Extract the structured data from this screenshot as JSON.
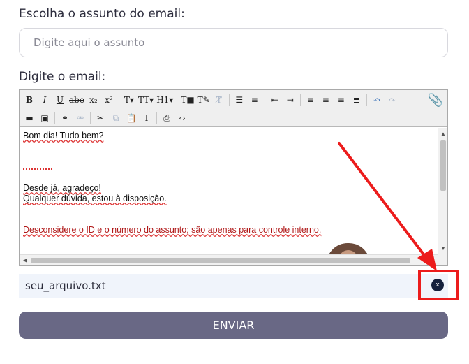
{
  "form": {
    "subject_label": "Escolha o assunto do email:",
    "subject_placeholder": "Digite aqui o assunto",
    "subject_value": "",
    "email_label": "Digite o email:",
    "send_label": "ENVIAR"
  },
  "toolbar": {
    "row1": [
      {
        "name": "bold-button",
        "glyph": "B"
      },
      {
        "name": "italic-button",
        "glyph": "I"
      },
      {
        "name": "underline-button",
        "glyph": "U"
      },
      {
        "name": "strikethrough-button",
        "glyph": "abe"
      },
      {
        "name": "subscript-button",
        "glyph": "x₂"
      },
      {
        "name": "superscript-button",
        "glyph": "x²"
      },
      {
        "name": "font-family-button",
        "glyph": "T▾"
      },
      {
        "name": "font-size-button",
        "glyph": "TT▾"
      },
      {
        "name": "heading-button",
        "glyph": "H1▾"
      },
      {
        "name": "text-color-button",
        "glyph": "T■"
      },
      {
        "name": "highlight-button",
        "glyph": "T✎"
      },
      {
        "name": "clear-format-button",
        "glyph": "T̸"
      },
      {
        "name": "bullet-list-button",
        "glyph": "☰"
      },
      {
        "name": "numbered-list-button",
        "glyph": "≡"
      },
      {
        "name": "outdent-button",
        "glyph": "⇤"
      },
      {
        "name": "indent-button",
        "glyph": "⇥"
      },
      {
        "name": "align-left-button",
        "glyph": "≡"
      },
      {
        "name": "align-center-button",
        "glyph": "≡"
      },
      {
        "name": "align-right-button",
        "glyph": "≡"
      },
      {
        "name": "justify-button",
        "glyph": "≣"
      },
      {
        "name": "undo-button",
        "glyph": "↶"
      },
      {
        "name": "redo-button",
        "glyph": "↷"
      }
    ],
    "row2": [
      {
        "name": "horizontal-rule-button",
        "glyph": "▬"
      },
      {
        "name": "insert-image-button",
        "glyph": "▣"
      },
      {
        "name": "insert-link-button",
        "glyph": "⚭"
      },
      {
        "name": "unlink-button",
        "glyph": "⚮"
      },
      {
        "name": "cut-button",
        "glyph": "✂"
      },
      {
        "name": "copy-button",
        "glyph": "⧉"
      },
      {
        "name": "paste-button",
        "glyph": "📋"
      },
      {
        "name": "paste-text-button",
        "glyph": "T"
      },
      {
        "name": "print-button",
        "glyph": "⎙"
      },
      {
        "name": "source-code-button",
        "glyph": "‹›"
      }
    ],
    "attach_icon": "paperclip-icon"
  },
  "editor": {
    "line1": "Bom dia! Tudo bem?",
    "line2": "Desde já, agradeço!",
    "line3": "Qualquer dúvida, estou à disposição.",
    "line4": "Desconsidere o ID e o número do assunto; são apenas para controle interno."
  },
  "attachment": {
    "file_name": "seu_arquivo.txt",
    "remove_label": "x"
  },
  "colors": {
    "send_button": "#696885",
    "remove_button": "#16213d",
    "annotation": "#ec1c1c",
    "editor_red_text": "#b01818"
  }
}
